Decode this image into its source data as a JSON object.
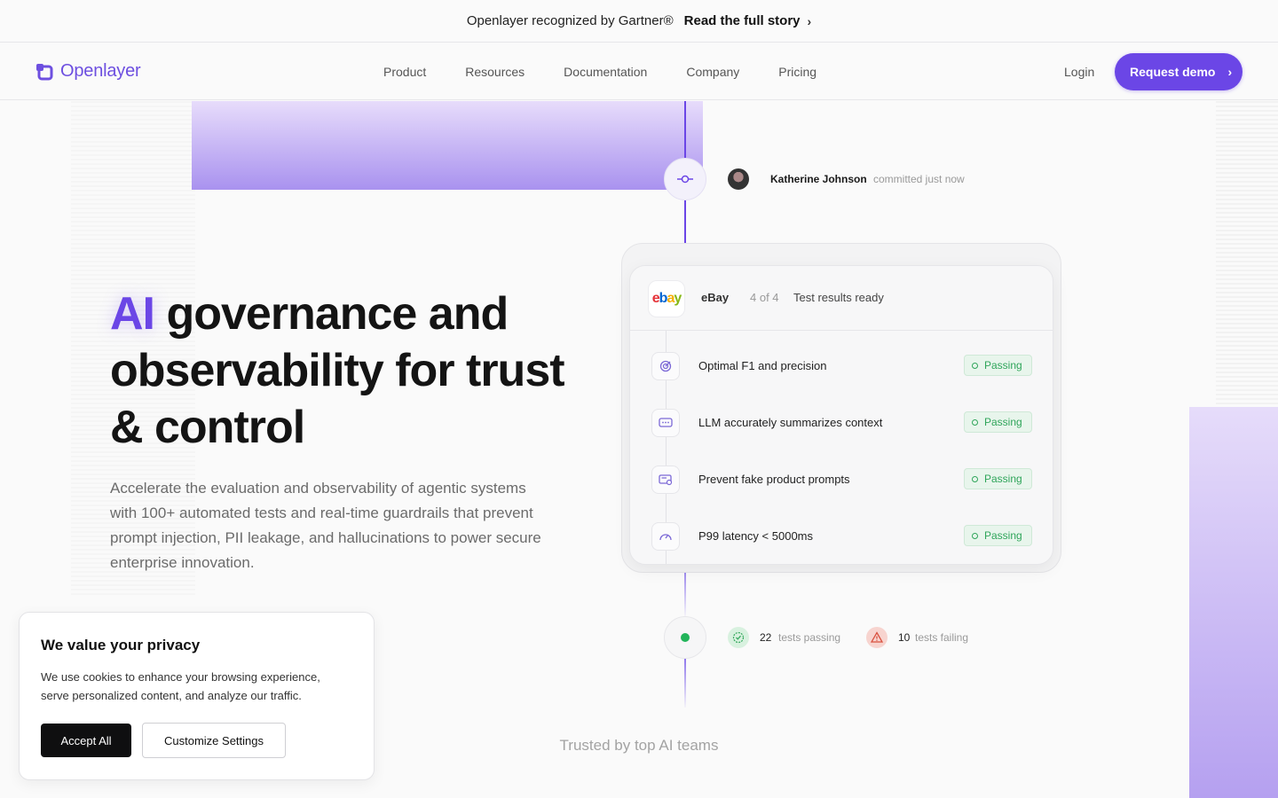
{
  "announcement": {
    "text": "Openlayer recognized by Gartner®",
    "link_label": "Read the full story",
    "chevron": "›"
  },
  "nav": {
    "brand": "Openlayer",
    "items": [
      {
        "label": "Product"
      },
      {
        "label": "Resources"
      },
      {
        "label": "Documentation"
      },
      {
        "label": "Company"
      },
      {
        "label": "Pricing"
      }
    ],
    "login": "Login",
    "cta": "Request demo",
    "cta_chevron": "›"
  },
  "hero": {
    "title_highlight": "AI",
    "title_rest": " governance and observability for trust & control",
    "subtitle": "Accelerate the evaluation and observability of agentic systems with 100+ automated tests and real-time guardrails that prevent prompt injection, PII leakage, and hallucinations to power secure enterprise innovation.",
    "accent_color": "#6b46e6"
  },
  "commit": {
    "author": "Katherine Johnson",
    "meta": "committed just now"
  },
  "test_card": {
    "logo_text": [
      "e",
      "b",
      "a",
      "y"
    ],
    "logo_colors": [
      "#e53238",
      "#0064d2",
      "#f5af02",
      "#86b817"
    ],
    "company": "eBay",
    "count": "4 of 4",
    "status": "Test results ready",
    "tests": [
      {
        "label": "Optimal F1 and precision",
        "status": "Passing",
        "icon": "target-icon"
      },
      {
        "label": "LLM accurately summarizes context",
        "status": "Passing",
        "icon": "chat-icon"
      },
      {
        "label": "Prevent fake product prompts",
        "status": "Passing",
        "icon": "shield-card-icon"
      },
      {
        "label": "P99 latency < 5000ms",
        "status": "Passing",
        "icon": "speedometer-icon"
      }
    ]
  },
  "summary": {
    "passing_count": "22",
    "passing_label": "tests passing",
    "failing_count": "10",
    "failing_label": "tests failing"
  },
  "trusted": {
    "heading": "Trusted by top AI teams"
  },
  "cookie": {
    "title": "We value your privacy",
    "body": "We use cookies to enhance your browsing experience, serve personalized content, and analyze our traffic.",
    "accept": "Accept All",
    "customize": "Customize Settings"
  }
}
